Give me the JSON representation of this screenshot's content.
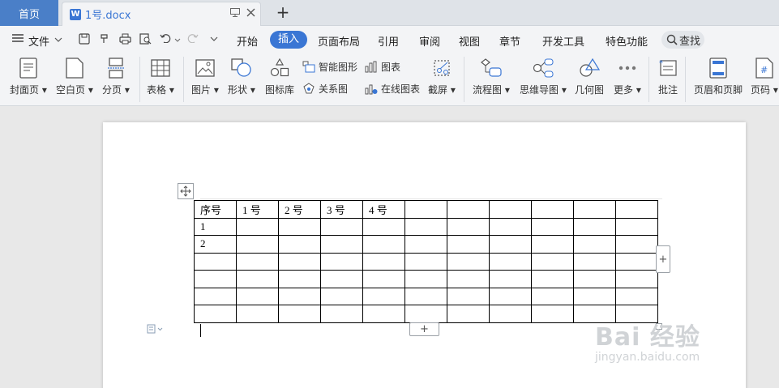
{
  "tabs": {
    "home": "首页",
    "document": "1号.docx",
    "doc_icon": "W"
  },
  "menu": {
    "file": "文件",
    "items": [
      "开始",
      "插入",
      "页面布局",
      "引用",
      "审阅",
      "视图",
      "章节",
      "开发工具",
      "特色功能"
    ],
    "active": "插入",
    "search": "查找"
  },
  "ribbon": {
    "cover": "封面页",
    "blank": "空白页",
    "paging": "分页",
    "table": "表格",
    "picture": "图片",
    "shape": "形状",
    "icon_lib": "图标库",
    "smart_shape": "智能图形",
    "chart": "图表",
    "relation": "关系图",
    "online_chart": "在线图表",
    "screenshot": "截屏",
    "flowchart": "流程图",
    "mindmap": "思维导图",
    "geometry": "几何图",
    "more": "更多",
    "comment": "批注",
    "header_footer": "页眉和页脚",
    "page_number": "页码"
  },
  "table": {
    "rows": [
      [
        "序号",
        "1 号",
        "2 号",
        "3 号",
        "4 号",
        "",
        "",
        "",
        "",
        "",
        ""
      ],
      [
        "1",
        "",
        "",
        "",
        "",
        "",
        "",
        "",
        "",
        "",
        ""
      ],
      [
        "2",
        "",
        "",
        "",
        "",
        "",
        "",
        "",
        "",
        "",
        ""
      ],
      [
        "",
        "",
        "",
        "",
        "",
        "",
        "",
        "",
        "",
        "",
        ""
      ],
      [
        "",
        "",
        "",
        "",
        "",
        "",
        "",
        "",
        "",
        "",
        ""
      ],
      [
        "",
        "",
        "",
        "",
        "",
        "",
        "",
        "",
        "",
        "",
        ""
      ],
      [
        "",
        "",
        "",
        "",
        "",
        "",
        "",
        "",
        "",
        "",
        ""
      ]
    ]
  },
  "watermark": {
    "main": "Bai 经验",
    "sub": "jingyan.baidu.com"
  },
  "colors": {
    "accent": "#3a76d4",
    "home_tab": "#4a7fc8"
  }
}
